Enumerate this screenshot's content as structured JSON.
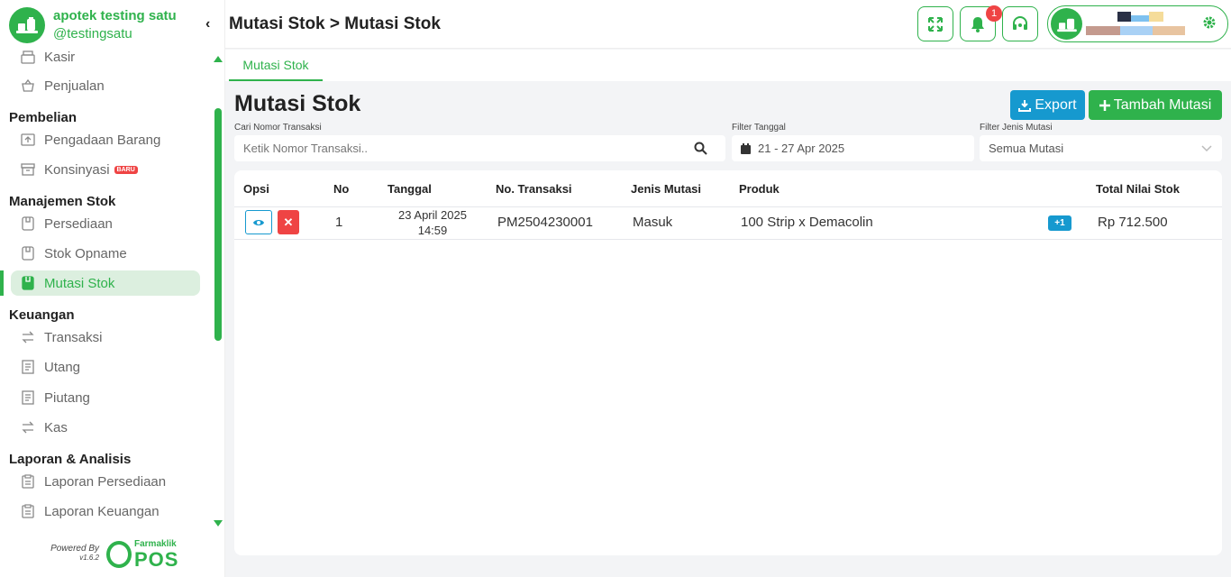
{
  "brand": {
    "name": "apotek testing satu",
    "handle": "@testingsatu"
  },
  "header": {
    "title": "Mutasi Stok > Mutasi Stok",
    "notification_count": "1"
  },
  "sidebar": {
    "items": [
      {
        "label": "Kasir"
      },
      {
        "label": "Penjualan"
      },
      {
        "section": "Pembelian"
      },
      {
        "label": "Pengadaan Barang"
      },
      {
        "label": "Konsinyasi",
        "badge": "BARU"
      },
      {
        "section": "Manajemen Stok"
      },
      {
        "label": "Persediaan"
      },
      {
        "label": "Stok Opname"
      },
      {
        "label": "Mutasi Stok"
      },
      {
        "section": "Keuangan"
      },
      {
        "label": "Transaksi"
      },
      {
        "label": "Utang"
      },
      {
        "label": "Piutang"
      },
      {
        "label": "Kas"
      },
      {
        "section": "Laporan & Analisis"
      },
      {
        "label": "Laporan Persediaan"
      },
      {
        "label": "Laporan Keuangan"
      }
    ],
    "powered_by": "Powered By",
    "version": "v1.6.2",
    "pos_brand_top": "Farmaklik",
    "pos_brand_bottom": "POS"
  },
  "tabs": [
    {
      "label": "Mutasi Stok"
    }
  ],
  "main": {
    "title": "Mutasi Stok",
    "export_label": "Export",
    "add_label": "Tambah Mutasi",
    "filters": {
      "search_label": "Cari Nomor Transaksi",
      "search_placeholder": "Ketik Nomor Transaksi..",
      "date_label": "Filter Tanggal",
      "date_value": "21 - 27 Apr 2025",
      "type_label": "Filter Jenis Mutasi",
      "type_value": "Semua Mutasi"
    },
    "columns": [
      "Opsi",
      "No",
      "Tanggal",
      "No. Transaksi",
      "Jenis Mutasi",
      "Produk",
      "Total Nilai Stok"
    ],
    "rows": [
      {
        "no": "1",
        "date": "23 April 2025",
        "time": "14:59",
        "trx": "PM2504230001",
        "type": "Masuk",
        "product": "100 Strip x Demacolin",
        "extra": "+1",
        "total": "Rp 712.500"
      }
    ]
  },
  "colors": {
    "accent": "#2fb24c",
    "info": "#1699cf",
    "danger": "#ef4444"
  }
}
